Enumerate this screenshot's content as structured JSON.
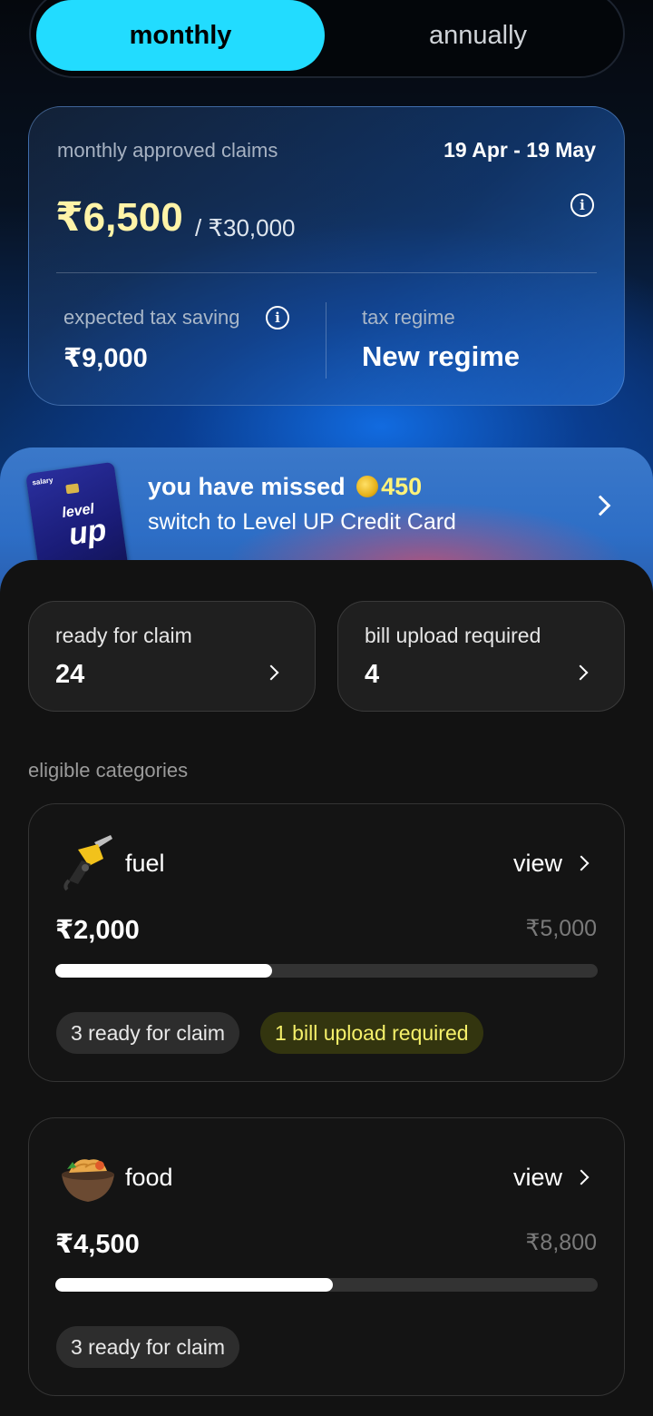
{
  "period_toggle": {
    "monthly": "monthly",
    "annually": "annually"
  },
  "summary": {
    "label": "monthly approved claims",
    "date_range": "19 Apr - 19 May",
    "approved_amount": "₹6,500",
    "limit": "/ ₹30,000",
    "tax_saving_label": "expected tax saving",
    "tax_saving_value": "₹9,000",
    "tax_regime_label": "tax regime",
    "tax_regime_value": "New regime"
  },
  "promo": {
    "missed_prefix": "you have missed",
    "missed_coins": "450",
    "cta_text": "switch to Level UP Credit Card",
    "card_brand": "salary",
    "card_text_1": "level",
    "card_text_2": "up"
  },
  "stats": {
    "ready": {
      "label": "ready for claim",
      "count": "24"
    },
    "upload": {
      "label": "bill upload required",
      "count": "4"
    }
  },
  "categories_label": "eligible categories",
  "categories": [
    {
      "name": "fuel",
      "icon": "fuel-nozzle-icon",
      "view_label": "view",
      "amount": "₹2,000",
      "max": "₹5,000",
      "progress": 0.4,
      "badges": [
        "3 ready for claim",
        "1 bill upload required"
      ]
    },
    {
      "name": "food",
      "icon": "food-bowl-icon",
      "view_label": "view",
      "amount": "₹4,500",
      "max": "₹8,800",
      "progress": 0.511,
      "badges": [
        "3 ready for claim"
      ]
    }
  ],
  "colors": {
    "accent": "#22dcff",
    "highlight_amount": "#fff4a8",
    "coin_text": "#fff27a",
    "warning_badge_text": "#f5f06a"
  }
}
